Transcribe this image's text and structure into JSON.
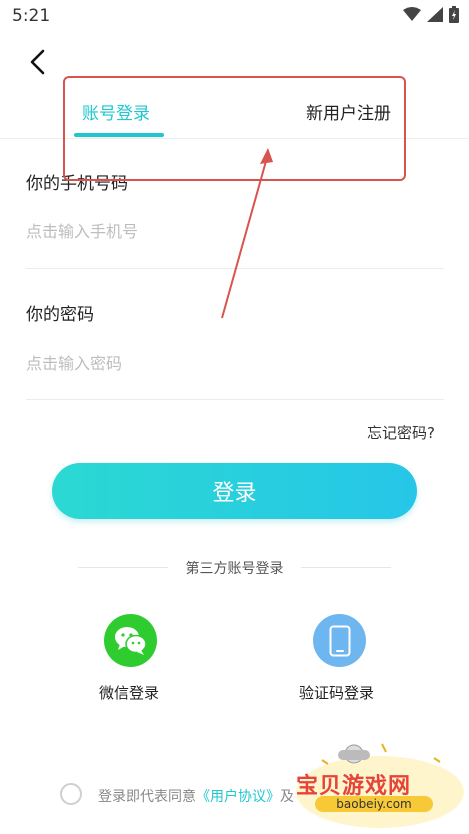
{
  "status_bar": {
    "time": "5:21"
  },
  "tabs": {
    "login": "账号登录",
    "register": "新用户注册",
    "active": "login"
  },
  "phone": {
    "label": "你的手机号码",
    "placeholder": "点击输入手机号",
    "value": ""
  },
  "password": {
    "label": "你的密码",
    "placeholder": "点击输入密码",
    "value": ""
  },
  "forgot_password": "忘记密码?",
  "login_button": "登录",
  "third_party": {
    "title": "第三方账号登录",
    "wechat_label": "微信登录",
    "sms_label": "验证码登录"
  },
  "agreement": {
    "prefix": "登录即代表同意",
    "user_agreement": "《用户协议》",
    "joiner": "及",
    "checked": false
  },
  "watermark": {
    "title": "宝贝游戏网",
    "url": "baobeiy.com"
  },
  "colors": {
    "accent": "#1fc7cf",
    "annotation": "#d9534f",
    "wechat": "#2ecc2f",
    "sms": "#6db6f0"
  }
}
